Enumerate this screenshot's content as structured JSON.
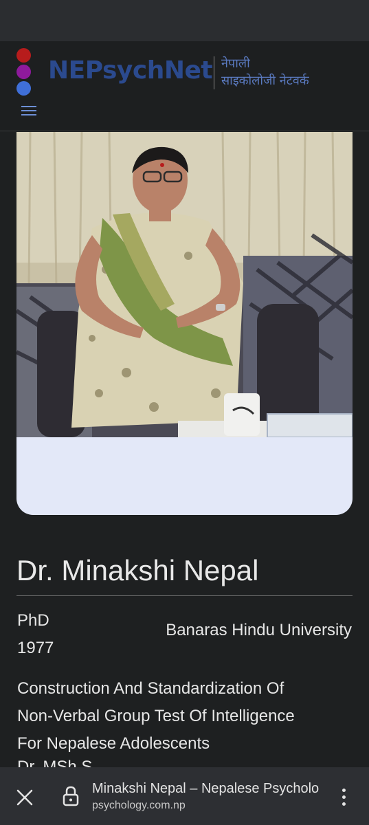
{
  "header": {
    "logo_text": "NEPsychNet",
    "logo_sub_line1": "नेपाली",
    "logo_sub_line2": "साइकोलोजी नेटवर्क",
    "dot_colors": [
      "#b71c1c",
      "#8e1a9c",
      "#3f6fd8"
    ],
    "logo_color": "#2b4a8e",
    "menu_icon": "hamburger-icon"
  },
  "profile": {
    "photo_alt": "Portrait of Dr. Minakshi Nepal",
    "name": "Dr.  Minakshi Nepal",
    "degree": "PhD",
    "year": "1977",
    "university": "Banaras Hindu University",
    "thesis_line1": "Construction And Standardization Of",
    "thesis_line2": "Non-Verbal Group Test Of Intelligence",
    "thesis_line3": "For Nepalese Adolescents",
    "cut_text": "Dr. MSh S..."
  },
  "browser": {
    "page_title": "Minakshi Nepal – Nepalese Psychologist",
    "url": "psychology.com.np",
    "close_icon": "close-icon",
    "lock_icon": "lock-icon",
    "more_icon": "more-vert-icon"
  }
}
